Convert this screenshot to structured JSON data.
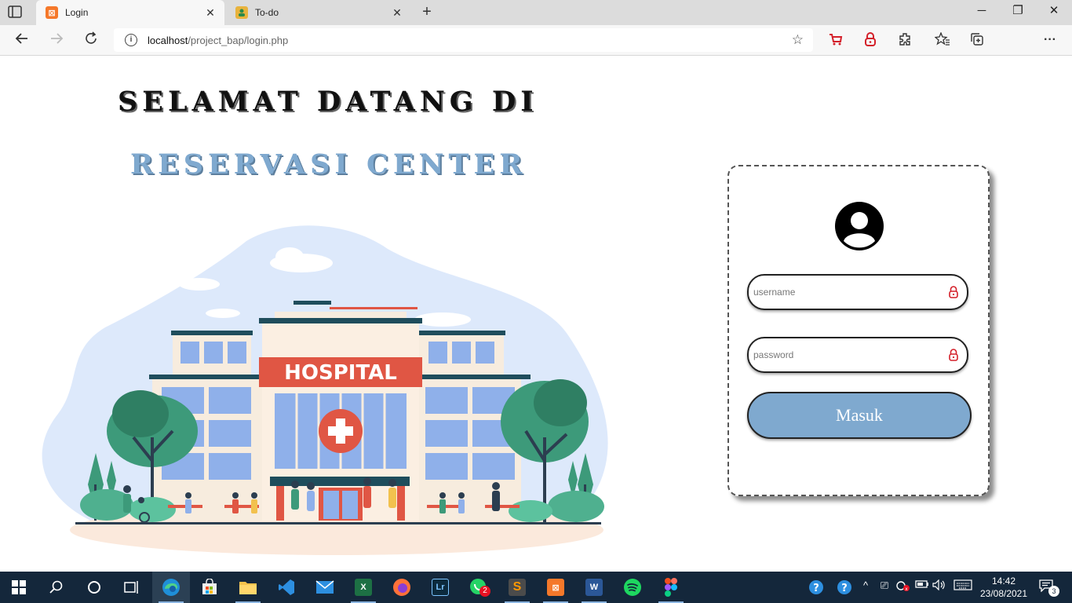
{
  "browser": {
    "tabs": [
      {
        "title": "Login",
        "active": true,
        "favicon": "xampp-icon"
      },
      {
        "title": "To-do",
        "active": false,
        "favicon": "todo-icon"
      }
    ],
    "address": {
      "host": "localhost",
      "path": "/project_bap/login.php"
    }
  },
  "page": {
    "heading_line1": "SELAMAT DATANG DI",
    "heading_line2": "RESERVASI CENTER",
    "illustration": {
      "sign_text": "HOSPITAL"
    },
    "login": {
      "username_placeholder": "username",
      "password_placeholder": "password",
      "submit_label": "Masuk"
    }
  },
  "taskbar": {
    "time": "14:42",
    "date": "23/08/2021",
    "whatsapp_badge": "2",
    "notification_count": "3"
  },
  "colors": {
    "accent": "#7fa9cf",
    "taskbar": "#14273b",
    "hospital_sign": "#e05644"
  }
}
